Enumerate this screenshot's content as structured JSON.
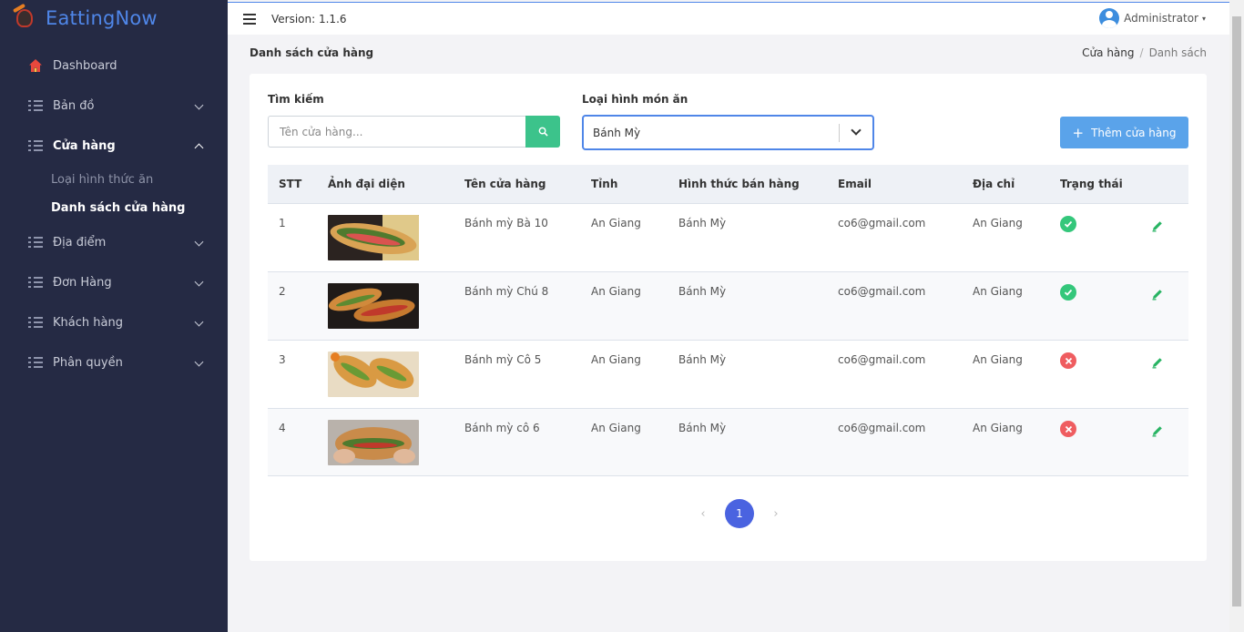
{
  "app": {
    "brand": "EattingNow",
    "version": "Version: 1.1.6",
    "user": "Administrator"
  },
  "sidebar": {
    "items": [
      {
        "label": "Dashboard"
      },
      {
        "label": "Bản đồ"
      },
      {
        "label": "Cửa hàng"
      },
      {
        "label": "Địa điểm"
      },
      {
        "label": "Đơn Hàng"
      },
      {
        "label": "Khách hàng"
      },
      {
        "label": "Phân quyền"
      }
    ],
    "subitems": [
      {
        "label": "Loại hình thức ăn"
      },
      {
        "label": "Danh sách cửa hàng"
      }
    ]
  },
  "page": {
    "title": "Danh sách cửa hàng",
    "breadcrumb": [
      "Cửa hàng",
      "Danh sách"
    ]
  },
  "filters": {
    "search_label": "Tìm kiếm",
    "search_placeholder": "Tên cửa hàng...",
    "search_value": "",
    "type_label": "Loại hình món ăn",
    "type_selected": "Bánh Mỳ",
    "add_button": "Thêm cửa hàng"
  },
  "table": {
    "headers": [
      "STT",
      "Ảnh đại diện",
      "Tên cửa hàng",
      "Tỉnh",
      "Hình thức bán hàng",
      "Email",
      "Địa chỉ",
      "Trạng thái"
    ],
    "rows": [
      {
        "stt": "1",
        "name": "Bánh mỳ Bà 10",
        "province": "An Giang",
        "type": "Bánh Mỳ",
        "email": "co6@gmail.com",
        "address": "An Giang",
        "status": "active"
      },
      {
        "stt": "2",
        "name": "Bánh mỳ Chú 8",
        "province": "An Giang",
        "type": "Bánh Mỳ",
        "email": "co6@gmail.com",
        "address": "An Giang",
        "status": "active"
      },
      {
        "stt": "3",
        "name": "Bánh mỳ Cô 5",
        "province": "An Giang",
        "type": "Bánh Mỳ",
        "email": "co6@gmail.com",
        "address": "An Giang",
        "status": "inactive"
      },
      {
        "stt": "4",
        "name": "Bánh mỳ cô 6",
        "province": "An Giang",
        "type": "Bánh Mỳ",
        "email": "co6@gmail.com",
        "address": "An Giang",
        "status": "inactive"
      }
    ]
  },
  "pagination": {
    "current": "1",
    "prev": "‹",
    "next": "›"
  },
  "colors": {
    "brand": "#4f86e8",
    "sidebar": "#252a44",
    "success": "#34c77b",
    "danger": "#ef5d60",
    "accent": "#4a63e0",
    "search_button": "#3cc38b"
  }
}
